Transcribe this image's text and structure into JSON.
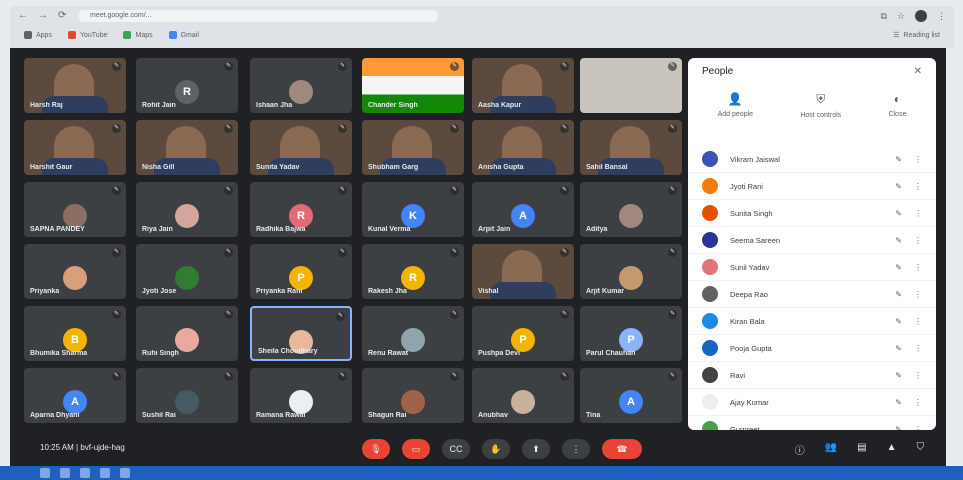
{
  "browser": {
    "url": "meet.google.com/...",
    "bookmarks": [
      {
        "label": "Apps",
        "color": "#5f6368"
      },
      {
        "label": "YouTube",
        "color": "#ea4335"
      },
      {
        "label": "Maps",
        "color": "#34a853"
      },
      {
        "label": "Gmail",
        "color": "#4285f4"
      }
    ],
    "reading_list": "Reading list"
  },
  "tiles": [
    {
      "name": "Harsh Raj",
      "kind": "video"
    },
    {
      "name": "Rohit Jain",
      "kind": "avatar",
      "initial": "R",
      "color": "#5f6368"
    },
    {
      "name": "Ishaan Jha",
      "kind": "avatar",
      "initial": "",
      "color": "#a1887f"
    },
    {
      "name": "Chander Singh",
      "kind": "flag"
    },
    {
      "name": "Aasha Kapur",
      "kind": "video"
    },
    {
      "name": "",
      "kind": "chart"
    },
    {
      "name": "Harshit Gaur",
      "kind": "video"
    },
    {
      "name": "Nisha Gill",
      "kind": "video"
    },
    {
      "name": "Sunita Yadav",
      "kind": "video"
    },
    {
      "name": "Shubham Garg",
      "kind": "video"
    },
    {
      "name": "Anisha Gupta",
      "kind": "video"
    },
    {
      "name": "Sahil Bansal",
      "kind": "video"
    },
    {
      "name": "SAPNA PANDEY",
      "kind": "avatar",
      "initial": "",
      "color": "#8d6e63"
    },
    {
      "name": "Riya Jain",
      "kind": "avatar",
      "initial": "",
      "color": "#d4a59a"
    },
    {
      "name": "Radhika Bajwa",
      "kind": "avatar",
      "initial": "R",
      "color": "#e06b74"
    },
    {
      "name": "Kunal Verma",
      "kind": "avatar",
      "initial": "K",
      "color": "#4285f4"
    },
    {
      "name": "Arpit Jain",
      "kind": "avatar",
      "initial": "A",
      "color": "#4285f4"
    },
    {
      "name": "Aditya",
      "kind": "avatar",
      "initial": "",
      "color": "#a1887f"
    },
    {
      "name": "Priyanka",
      "kind": "avatar",
      "initial": "",
      "color": "#d7a07a"
    },
    {
      "name": "Jyoti Jose",
      "kind": "avatar",
      "initial": "",
      "color": "#2e7d32"
    },
    {
      "name": "Priyanka Rani",
      "kind": "avatar",
      "initial": "P",
      "color": "#f4b400"
    },
    {
      "name": "Rakesh Jha",
      "kind": "avatar",
      "initial": "R",
      "color": "#f4b400"
    },
    {
      "name": "Vishal",
      "kind": "video"
    },
    {
      "name": "Arjit Kumar",
      "kind": "avatar",
      "initial": "",
      "color": "#c49a6c"
    },
    {
      "name": "Bhumika Sharma",
      "kind": "avatar",
      "initial": "B",
      "color": "#f4b400"
    },
    {
      "name": "Ruhi Singh",
      "kind": "avatar",
      "initial": "",
      "color": "#e8a9a0"
    },
    {
      "name": "Sheila Choudhary",
      "kind": "avatar",
      "initial": "",
      "color": "#e8b89a",
      "selected": true
    },
    {
      "name": "Renu Rawat",
      "kind": "avatar",
      "initial": "",
      "color": "#90a4ae"
    },
    {
      "name": "Pushpa Devi",
      "kind": "avatar",
      "initial": "P",
      "color": "#f4b400"
    },
    {
      "name": "Parul Chauhan",
      "kind": "avatar",
      "initial": "P",
      "color": "#8ab4f8"
    },
    {
      "name": "Aparna Dhyani",
      "kind": "avatar",
      "initial": "A",
      "color": "#4285f4"
    },
    {
      "name": "Sushil Rai",
      "kind": "avatar",
      "initial": "",
      "color": "#455a64"
    },
    {
      "name": "Ramana Rawal",
      "kind": "avatar",
      "initial": "",
      "color": "#eceff1"
    },
    {
      "name": "Shagun Rai",
      "kind": "avatar",
      "initial": "",
      "color": "#a1624a"
    },
    {
      "name": "Anubhav",
      "kind": "avatar",
      "initial": "",
      "color": "#c9b29b"
    },
    {
      "name": "Tina",
      "kind": "avatar",
      "initial": "A",
      "color": "#4285f4"
    }
  ],
  "bottom": {
    "time": "10:25 AM",
    "meeting_code": "bvf-ujde-hag",
    "controls": [
      "mic",
      "camera",
      "captions",
      "present",
      "raise-hand",
      "more",
      "end"
    ]
  },
  "panel": {
    "title": "People",
    "actions": [
      "Add people",
      "Host controls",
      "Close"
    ],
    "people": [
      {
        "name": "Vikram Jaiswal",
        "color": "#3f51b5"
      },
      {
        "name": "Jyoti Rani",
        "color": "#f57c00"
      },
      {
        "name": "Sunita Singh",
        "color": "#e65100"
      },
      {
        "name": "Seema Sareen",
        "color": "#283593"
      },
      {
        "name": "Sunil Yadav",
        "color": "#e57373"
      },
      {
        "name": "Deepa Rao",
        "color": "#616161"
      },
      {
        "name": "Kiran Bala",
        "color": "#1e88e5"
      },
      {
        "name": "Pooja Gupta",
        "color": "#1565c0"
      },
      {
        "name": "Ravi",
        "color": "#424242"
      },
      {
        "name": "Ajay Kumar",
        "color": "#eeeeee"
      },
      {
        "name": "Gurpreet",
        "color": "#43a047"
      }
    ]
  }
}
